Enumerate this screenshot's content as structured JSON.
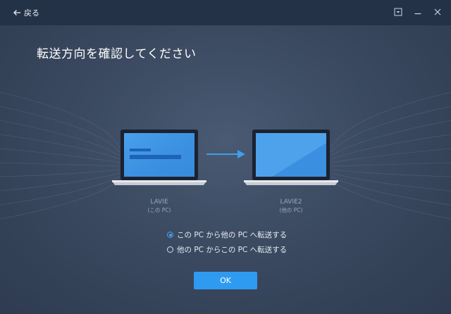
{
  "titlebar": {
    "back_label": "戻る"
  },
  "main": {
    "heading": "転送方向を確認してください",
    "source_device": {
      "name": "LAVIE",
      "sub": "(この PC)"
    },
    "target_device": {
      "name": "LAVIE2",
      "sub": "(他の PC)"
    },
    "options": [
      {
        "label": "この PC から他の PC へ転送する",
        "checked": true
      },
      {
        "label": "他の PC からこの PC へ転送する",
        "checked": false
      }
    ],
    "ok_label": "OK"
  },
  "colors": {
    "accent": "#2e9bf0",
    "titlebar_bg": "#243247",
    "background": "#3b4a61"
  }
}
